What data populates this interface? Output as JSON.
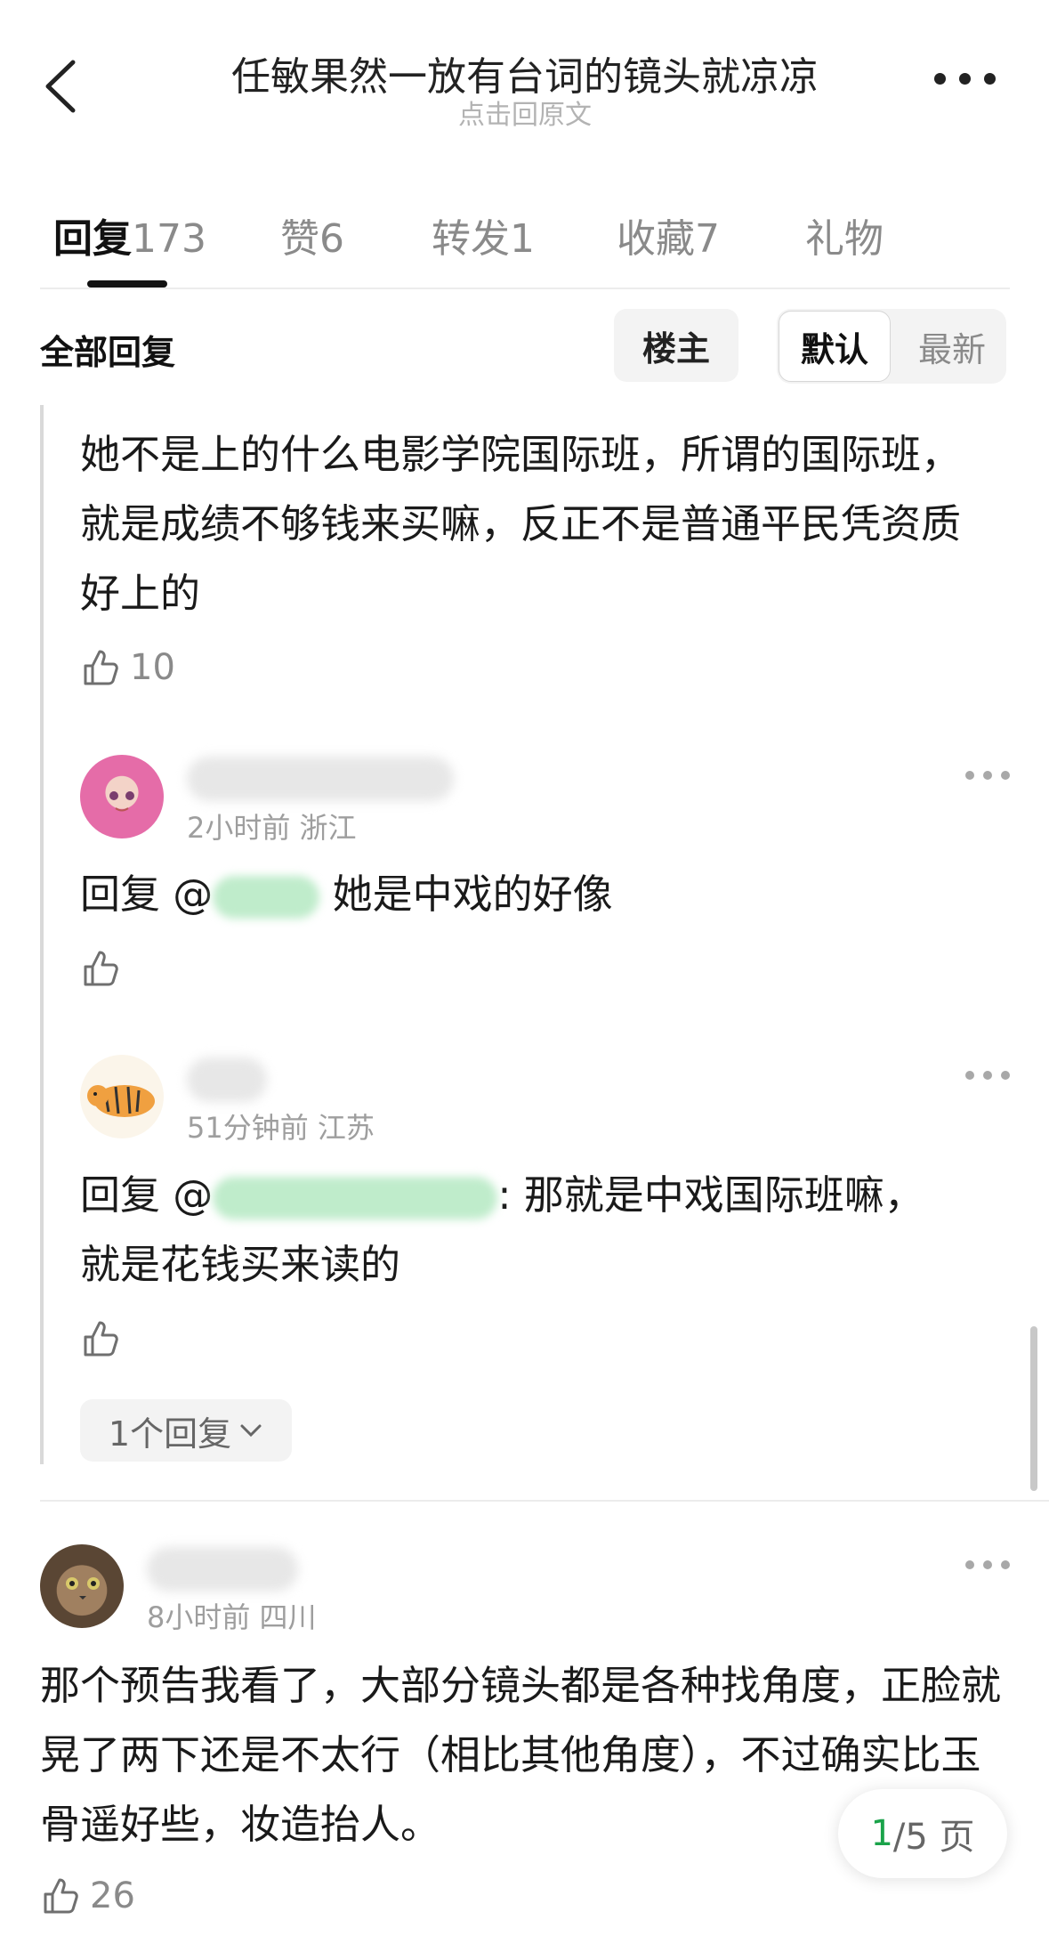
{
  "header": {
    "title": "任敏果然一放有台词的镜头就凉凉",
    "subtitle": "点击回原文"
  },
  "tabs": [
    {
      "label": "回复",
      "count": "173"
    },
    {
      "label": "赞",
      "count": "6"
    },
    {
      "label": "转发",
      "count": "1"
    },
    {
      "label": "收藏",
      "count": "7"
    },
    {
      "label": "礼物",
      "count": ""
    }
  ],
  "filter": {
    "all_replies": "全部回复",
    "owner": "楼主",
    "default": "默认",
    "latest": "最新"
  },
  "thread": {
    "top_text": "她不是上的什么电影学院国际班，所谓的国际班，就是成绩不够钱来买嘛，反正不是普通平民凭资质好上的",
    "top_likes": "10",
    "reply1": {
      "meta": "2小时前 浙江",
      "prefix": "回复 @",
      "text": " 她是中戏的好像"
    },
    "reply2": {
      "meta": "51分钟前 江苏",
      "prefix": "回复 @",
      "suffix": ": 那就是中戏国际班嘛，",
      "text2": "就是花钱买来读的"
    },
    "more_replies": "1个回复"
  },
  "comment": {
    "meta": "8小时前 四川",
    "text": "那个预告我看了，大部分镜头都是各种找角度，正脸就晃了两下还是不太行（相比其他角度），不过确实比玉骨遥好些，妆造抬人。",
    "likes": "26"
  },
  "pager": {
    "current": "1",
    "total": "/5 页"
  },
  "colors": {
    "accent_green": "#1aa34a",
    "muted": "#8a8a8a"
  }
}
